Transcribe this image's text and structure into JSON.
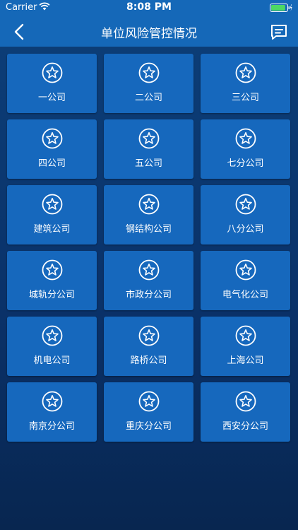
{
  "status_bar": {
    "carrier": "Carrier",
    "time": "8:08 PM",
    "wifi_icon": "wifi-icon",
    "battery_icon": "battery-icon",
    "battery_level": 0.9
  },
  "nav": {
    "title": "单位风险管控情况",
    "back_icon": "chevron-left-icon",
    "message_icon": "message-icon"
  },
  "colors": {
    "header_bg": "#1568b8",
    "tile_bg": "#1668bd",
    "page_bg": "#0a3168"
  },
  "tile_icon": "star-circle-icon",
  "companies": [
    {
      "label": "一公司"
    },
    {
      "label": "二公司"
    },
    {
      "label": "三公司"
    },
    {
      "label": "四公司"
    },
    {
      "label": "五公司"
    },
    {
      "label": "七分公司"
    },
    {
      "label": "建筑公司"
    },
    {
      "label": "钢结构公司"
    },
    {
      "label": "八分公司"
    },
    {
      "label": "城轨分公司"
    },
    {
      "label": "市政分公司"
    },
    {
      "label": "电气化公司"
    },
    {
      "label": "机电公司"
    },
    {
      "label": "路桥公司"
    },
    {
      "label": "上海公司"
    },
    {
      "label": "南京分公司"
    },
    {
      "label": "重庆分公司"
    },
    {
      "label": "西安分公司"
    }
  ]
}
